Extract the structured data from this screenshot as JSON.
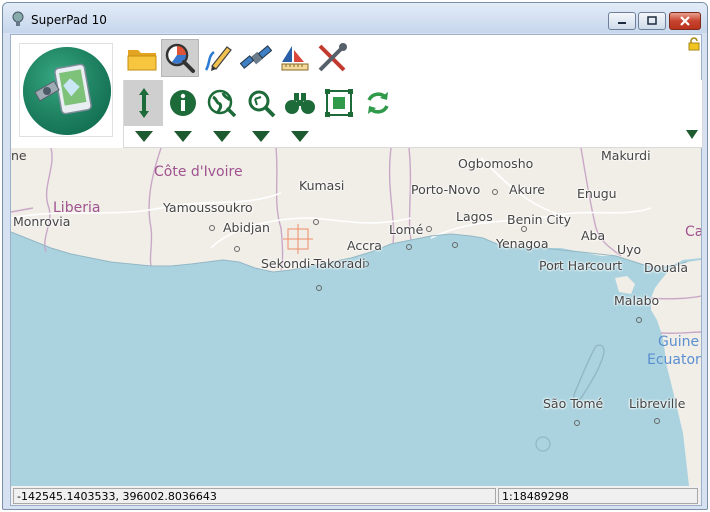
{
  "window": {
    "title": "SuperPad 10"
  },
  "toolbar_row1": [
    {
      "icon": "folder-icon"
    },
    {
      "icon": "query-chart-icon"
    },
    {
      "icon": "pencil-draw-icon"
    },
    {
      "icon": "satellite-icon"
    },
    {
      "icon": "boat-ruler-icon"
    },
    {
      "icon": "tools-icon"
    }
  ],
  "toolbar_row2": [
    {
      "icon": "pan-arrows-icon"
    },
    {
      "icon": "info-icon"
    },
    {
      "icon": "globe-icon"
    },
    {
      "icon": "zoom-icon"
    },
    {
      "icon": "binoculars-icon"
    },
    {
      "icon": "select-frame-icon"
    },
    {
      "icon": "refresh-icon"
    }
  ],
  "map": {
    "labels": {
      "cote_divoire": "Côte d'Ivoire",
      "liberia": "Liberia",
      "monrovia": "Monrovia",
      "yamoussoukro": "Yamoussoukro",
      "abidjan": "Abidjan",
      "kumasi": "Kumasi",
      "accra": "Accra",
      "sekondi": "Sekondi-Takoradi",
      "lome": "Lomé",
      "porto_novo": "Porto-Novo",
      "lagos": "Lagos",
      "ogbomosho": "Ogbomosho",
      "akure": "Akure",
      "benin_city": "Benin City",
      "makurdi": "Makurdi",
      "enugu": "Enugu",
      "aba": "Aba",
      "yenagoa": "Yenagoa",
      "uyo": "Uyo",
      "port_harcourt": "Port Harcourt",
      "douala": "Douala",
      "malabo": "Malabo",
      "sao_tome": "São Tomé",
      "libreville": "Libreville",
      "guine": "Guine",
      "ecuator": "Ecuator",
      "ca": "Ca",
      "ne": "ne"
    },
    "colors": {
      "land": "#f1eee8",
      "water": "#aad3df"
    }
  },
  "status": {
    "coordinates": "-142545.1403533, 396002.8036643",
    "scale": "1:18489298"
  }
}
